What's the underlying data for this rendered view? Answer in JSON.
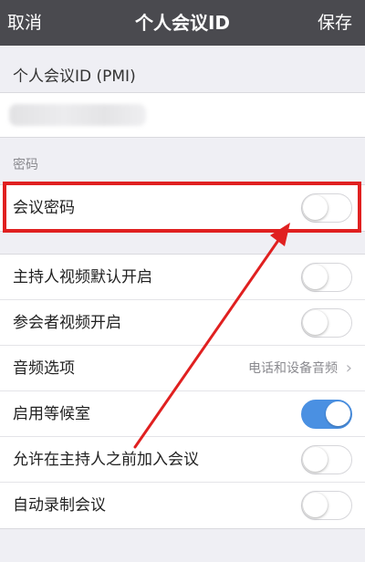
{
  "nav": {
    "cancel_label": "取消",
    "title": "个人会议ID",
    "save_label": "保存"
  },
  "pmi": {
    "label": "个人会议ID (PMI)"
  },
  "password_section": {
    "header": "密码",
    "meeting_password_label": "会议密码",
    "meeting_password_on": false
  },
  "settings": {
    "host_video_label": "主持人视频默认开启",
    "host_video_on": false,
    "participant_video_label": "参会者视频开启",
    "participant_video_on": false,
    "audio_label": "音频选项",
    "audio_value": "电话和设备音频",
    "waiting_room_label": "启用等候室",
    "waiting_room_on": true,
    "join_before_host_label": "允许在主持人之前加入会议",
    "join_before_host_on": false,
    "auto_record_label": "自动录制会议",
    "auto_record_on": false
  },
  "colors": {
    "nav_bg": "#4a4a4f",
    "toggle_on": "#4a90e2",
    "annotation_red": "#e02020"
  }
}
